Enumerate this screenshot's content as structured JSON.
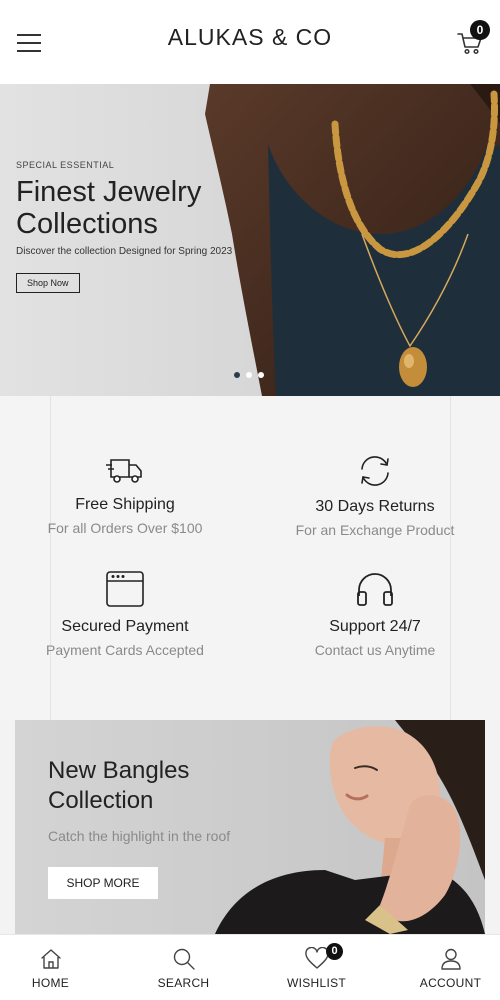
{
  "header": {
    "brand": "ALUKAS & CO",
    "cart_count": "0"
  },
  "hero": {
    "eyebrow": "SPECIAL ESSENTIAL",
    "title_line1": "Finest Jewelry",
    "title_line2": "Collections",
    "description": "Discover the collection Designed for Spring 2023",
    "button": "Shop Now",
    "slides_total": 3,
    "active_slide": 1
  },
  "features": [
    {
      "icon": "delivery-truck-icon",
      "title": "Free Shipping",
      "subtitle": "For all Orders Over $100"
    },
    {
      "icon": "refresh-icon",
      "title": "30 Days Returns",
      "subtitle": "For an Exchange Product"
    },
    {
      "icon": "browser-window-icon",
      "title": "Secured Payment",
      "subtitle": "Payment Cards Accepted"
    },
    {
      "icon": "headphones-icon",
      "title": "Support 24/7",
      "subtitle": "Contact us Anytime"
    }
  ],
  "promo": {
    "title_line1": "New Bangles",
    "title_line2": "Collection",
    "subtitle": "Catch the highlight in the roof",
    "button": "SHOP MORE"
  },
  "bottom_nav": {
    "items": [
      {
        "icon": "home-icon",
        "label": "HOME"
      },
      {
        "icon": "search-icon",
        "label": "SEARCH"
      },
      {
        "icon": "heart-icon",
        "label": "WISHLIST"
      },
      {
        "icon": "user-icon",
        "label": "ACCOUNT"
      }
    ],
    "wishlist_count": "0"
  },
  "colors": {
    "header_bg": "#ffffff",
    "page_bg": "#f3f3f3",
    "text": "#222222",
    "muted_text": "#8a8a8a",
    "badge": "#111111",
    "gold": "#c9973f",
    "top_navy": "#1f2e3b"
  }
}
